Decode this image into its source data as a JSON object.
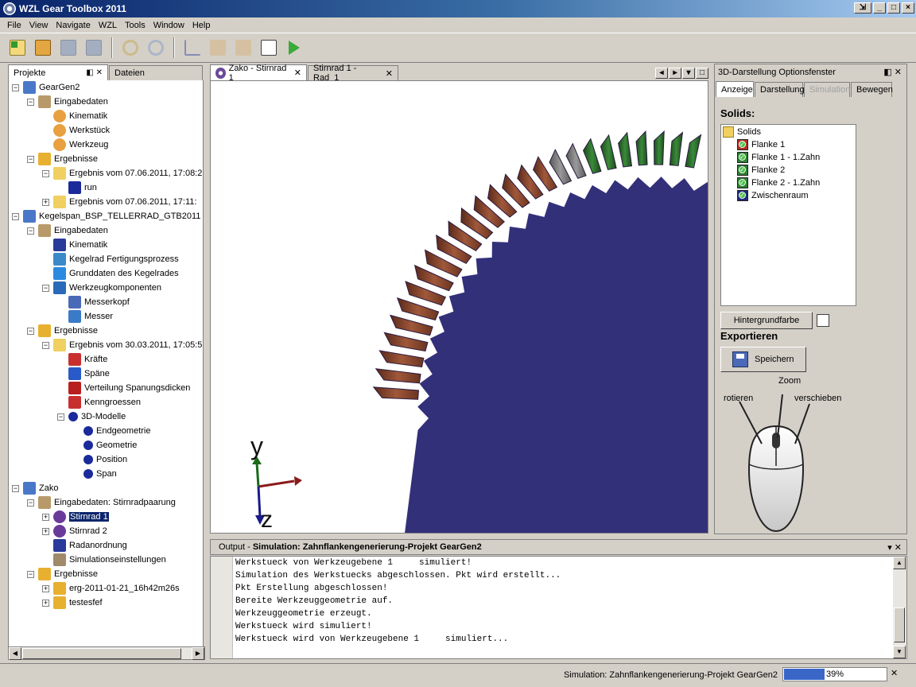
{
  "window": {
    "title": "WZL Gear Toolbox 2011"
  },
  "menu": [
    "File",
    "View",
    "Navigate",
    "WZL",
    "Tools",
    "Window",
    "Help"
  ],
  "toolbar_icons": [
    "new-project-icon",
    "open-project-icon",
    "save-icon",
    "save-all-icon",
    "undo-icon",
    "redo-icon",
    "kinematics-icon",
    "import-icon",
    "export-icon",
    "preview-icon",
    "run-icon"
  ],
  "left_panel": {
    "tabs": [
      "Projekte",
      "Dateien"
    ],
    "tree": [
      {
        "label": "GearGen2",
        "level": 0,
        "exp": "-",
        "icon": "project"
      },
      {
        "label": "Eingabedaten",
        "level": 1,
        "exp": "-",
        "icon": "input"
      },
      {
        "label": "Kinematik",
        "level": 2,
        "exp": "",
        "icon": "gear-orange"
      },
      {
        "label": "Werkstück",
        "level": 2,
        "exp": "",
        "icon": "gear-orange"
      },
      {
        "label": "Werkzeug",
        "level": 2,
        "exp": "",
        "icon": "gear-orange"
      },
      {
        "label": "Ergebnisse",
        "level": 1,
        "exp": "-",
        "icon": "results"
      },
      {
        "label": "Ergebnis vom 07.06.2011, 17:08:2",
        "level": 2,
        "exp": "-",
        "icon": "folder"
      },
      {
        "label": "run",
        "level": 3,
        "exp": "",
        "icon": "run"
      },
      {
        "label": "Ergebnis vom 07.06.2011, 17:11:",
        "level": 2,
        "exp": "+",
        "icon": "folder"
      },
      {
        "label": "Kegelspan_BSP_TELLERRAD_GTB2011",
        "level": 0,
        "exp": "-",
        "icon": "project"
      },
      {
        "label": "Eingabedaten",
        "level": 1,
        "exp": "-",
        "icon": "input"
      },
      {
        "label": "Kinematik",
        "level": 2,
        "exp": "",
        "icon": "kinematics"
      },
      {
        "label": "Kegelrad Fertigungsprozess",
        "level": 2,
        "exp": "",
        "icon": "process"
      },
      {
        "label": "Grunddaten des Kegelrades",
        "level": 2,
        "exp": "",
        "icon": "cone"
      },
      {
        "label": "Werkzeugkomponenten",
        "level": 2,
        "exp": "-",
        "icon": "tool"
      },
      {
        "label": "Messerkopf",
        "level": 3,
        "exp": "",
        "icon": "cutter"
      },
      {
        "label": "Messer",
        "level": 3,
        "exp": "",
        "icon": "blade"
      },
      {
        "label": "Ergebnisse",
        "level": 1,
        "exp": "-",
        "icon": "results"
      },
      {
        "label": "Ergebnis vom 30.03.2011, 17:05:5",
        "level": 2,
        "exp": "-",
        "icon": "folder"
      },
      {
        "label": "Kräfte",
        "level": 3,
        "exp": "",
        "icon": "chart"
      },
      {
        "label": "Späne",
        "level": 3,
        "exp": "",
        "icon": "chip"
      },
      {
        "label": "Verteilung Spanungsdicken",
        "level": 3,
        "exp": "",
        "icon": "bars"
      },
      {
        "label": "Kenngroessen",
        "level": 3,
        "exp": "",
        "icon": "chart"
      },
      {
        "label": "3D-Modelle",
        "level": 3,
        "exp": "-",
        "icon": "3d"
      },
      {
        "label": "Endgeometrie",
        "level": 4,
        "exp": "",
        "icon": "3d"
      },
      {
        "label": "Geometrie",
        "level": 4,
        "exp": "",
        "icon": "3d"
      },
      {
        "label": "Position",
        "level": 4,
        "exp": "",
        "icon": "3d"
      },
      {
        "label": "Span",
        "level": 4,
        "exp": "",
        "icon": "3d"
      },
      {
        "label": "Zako",
        "level": 0,
        "exp": "-",
        "icon": "project"
      },
      {
        "label": "Eingabedaten: Stirnradpaarung",
        "level": 1,
        "exp": "-",
        "icon": "input"
      },
      {
        "label": "Stirnrad 1",
        "level": 2,
        "exp": "+",
        "icon": "gear-purple",
        "selected": true
      },
      {
        "label": "Stirnrad 2",
        "level": 2,
        "exp": "+",
        "icon": "gear-purple"
      },
      {
        "label": "Radanordnung",
        "level": 2,
        "exp": "",
        "icon": "kinematics"
      },
      {
        "label": "Simulationseinstellungen",
        "level": 2,
        "exp": "",
        "icon": "settings"
      },
      {
        "label": "Ergebnisse",
        "level": 1,
        "exp": "-",
        "icon": "results"
      },
      {
        "label": "erg-2011-01-21_16h42m26s",
        "level": 2,
        "exp": "+",
        "icon": "results"
      },
      {
        "label": "testesfef",
        "level": 2,
        "exp": "+",
        "icon": "results"
      }
    ]
  },
  "editor_tabs": [
    {
      "label": "Zako - Stirnrad 1",
      "active": true
    },
    {
      "label": "Stirnrad 1 - Rad_1",
      "active": false
    }
  ],
  "viewport": {
    "axis_y": "y",
    "axis_z": "z"
  },
  "right_panel": {
    "title": "3D-Darstellung Optionsfenster",
    "tabs": [
      {
        "label": "Anzeige",
        "state": "active"
      },
      {
        "label": "Darstellung",
        "state": "normal"
      },
      {
        "label": "Simulation",
        "state": "disabled"
      },
      {
        "label": "Bewegen",
        "state": "normal"
      }
    ],
    "solids_heading": "Solids:",
    "solids": [
      {
        "label": "Solids",
        "type": "folder"
      },
      {
        "label": "Flanke 1",
        "color": "#b03020"
      },
      {
        "label": "Flanke 1 - 1.Zahn",
        "color": "#2e7d32"
      },
      {
        "label": "Flanke 2",
        "color": "#2e7d32"
      },
      {
        "label": "Flanke 2 - 1.Zahn",
        "color": "#2e7d32"
      },
      {
        "label": "Zwischenraum",
        "color": "#1e2a7a"
      }
    ],
    "background_button": "Hintergrundfarbe",
    "export_heading": "Exportieren",
    "save_button": "Speichern",
    "mouse": {
      "rotate": "rotieren",
      "zoom": "Zoom",
      "move": "verschieben"
    }
  },
  "output": {
    "label": "Output",
    "title": "Simulation: Zahnflankengenerierung-Projekt GearGen2",
    "lines": [
      "Werkstueck von Werkzeugebene 1     simuliert!",
      "Simulation des Werkstuecks abgeschlossen. Pkt wird erstellt...",
      "Pkt Erstellung abgeschlossen!",
      "Bereite Werkzeuggeometrie auf.",
      "Werkzeuggeometrie erzeugt.",
      "Werkstueck wird simuliert!",
      "Werkstueck wird von Werkzeugebene 1     simuliert..."
    ]
  },
  "status": {
    "text": "Simulation: Zahnflankengenerierung-Projekt GearGen2",
    "progress_label": "39%",
    "progress_value": 0.39
  }
}
